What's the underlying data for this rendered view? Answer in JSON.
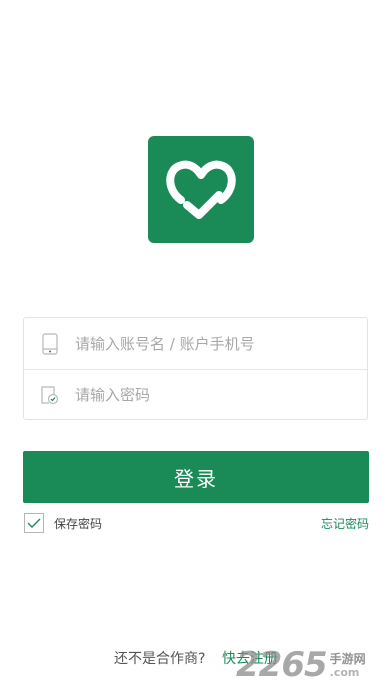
{
  "logo": {
    "icon": "heart-check-icon",
    "color": "#1a8a57"
  },
  "form": {
    "username_placeholder": "请输入账号名 / 账户手机号",
    "username_value": "",
    "password_placeholder": "请输入密码",
    "password_value": "",
    "login_label": "登录",
    "remember_label": "保存密码",
    "remember_checked": true,
    "forgot_label": "忘记密码"
  },
  "footer": {
    "prompt": "还不是合作商?",
    "register_label": "快去注册"
  },
  "watermark": {
    "digits": "2265",
    "cn": "手游网",
    "com": ".com"
  },
  "colors": {
    "brand": "#1a8a57"
  }
}
